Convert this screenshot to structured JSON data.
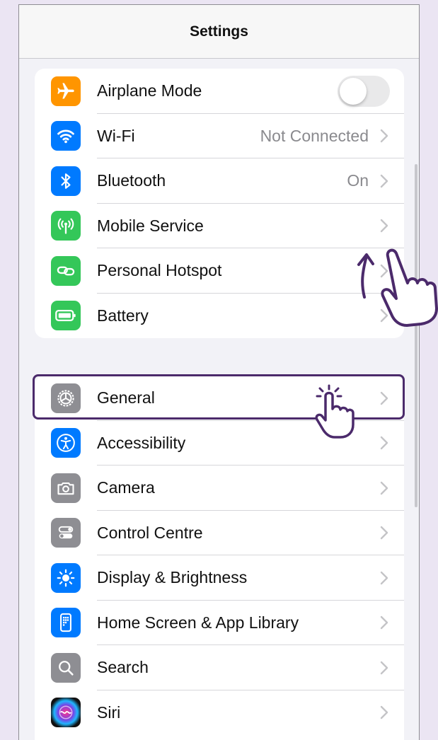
{
  "header": {
    "title": "Settings"
  },
  "group1": [
    {
      "label": "Airplane Mode",
      "icon": "airplane-icon",
      "color": "#ff9500",
      "type": "toggle",
      "on": false
    },
    {
      "label": "Wi-Fi",
      "icon": "wifi-icon",
      "color": "#007aff",
      "detail": "Not Connected"
    },
    {
      "label": "Bluetooth",
      "icon": "bluetooth-icon",
      "color": "#007aff",
      "detail": "On"
    },
    {
      "label": "Mobile Service",
      "icon": "antenna-icon",
      "color": "#34c759"
    },
    {
      "label": "Personal Hotspot",
      "icon": "hotspot-link-icon",
      "color": "#34c759"
    },
    {
      "label": "Battery",
      "icon": "battery-icon",
      "color": "#34c759"
    }
  ],
  "group2": [
    {
      "label": "General",
      "icon": "gear-icon",
      "color": "#8e8e93"
    },
    {
      "label": "Accessibility",
      "icon": "accessibility-icon",
      "color": "#007aff"
    },
    {
      "label": "Camera",
      "icon": "camera-icon",
      "color": "#8e8e93"
    },
    {
      "label": "Control Centre",
      "icon": "control-centre-icon",
      "color": "#8e8e93"
    },
    {
      "label": "Display & Brightness",
      "icon": "sun-icon",
      "color": "#007aff"
    },
    {
      "label": "Home Screen & App Library",
      "icon": "home-screen-icon",
      "color": "#007aff"
    },
    {
      "label": "Search",
      "icon": "search-icon",
      "color": "#8e8e93"
    },
    {
      "label": "Siri",
      "icon": "siri-icon",
      "color": "#1c1c3c"
    }
  ],
  "annotation": {
    "highlight_color": "#4b2a6b"
  }
}
